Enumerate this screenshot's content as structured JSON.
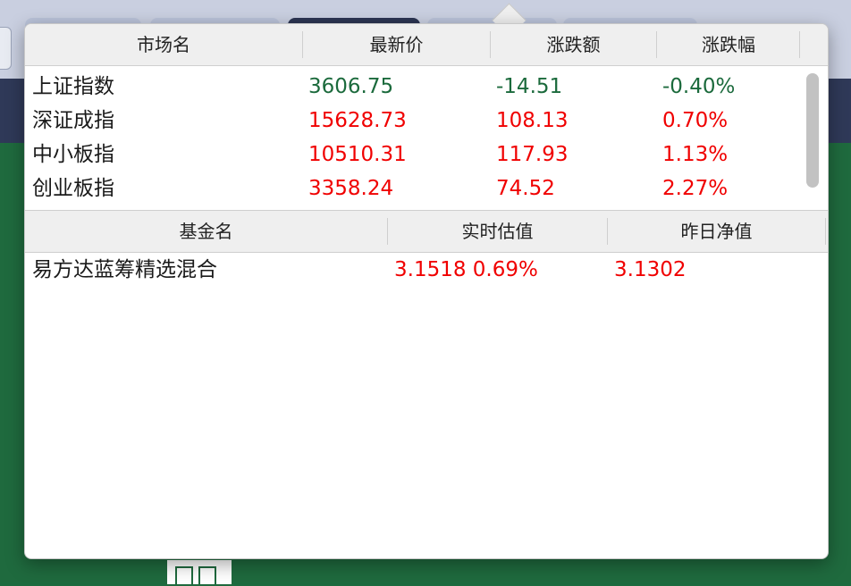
{
  "market_table": {
    "headers": [
      "市场名",
      "最新价",
      "涨跌额",
      "涨跌幅"
    ],
    "rows": [
      {
        "name": "上证指数",
        "price": "3606.75",
        "change": "-14.51",
        "pct": "-0.40%",
        "color": "#1b6a3c"
      },
      {
        "name": "深证成指",
        "price": "15628.73",
        "change": "108.13",
        "pct": "0.70%",
        "color": "#f00000"
      },
      {
        "name": "中小板指",
        "price": "10510.31",
        "change": "117.93",
        "pct": "1.13%",
        "color": "#f00000"
      },
      {
        "name": "创业板指",
        "price": "3358.24",
        "change": "74.52",
        "pct": "2.27%",
        "color": "#f00000"
      }
    ]
  },
  "fund_table": {
    "headers": [
      "基金名",
      "实时估值",
      "昨日净值"
    ],
    "rows": [
      {
        "name": "易方达蓝筹精选混合",
        "estimate": "3.1518 0.69%",
        "prev_nav": "3.1302",
        "color": "#f00000"
      }
    ]
  }
}
